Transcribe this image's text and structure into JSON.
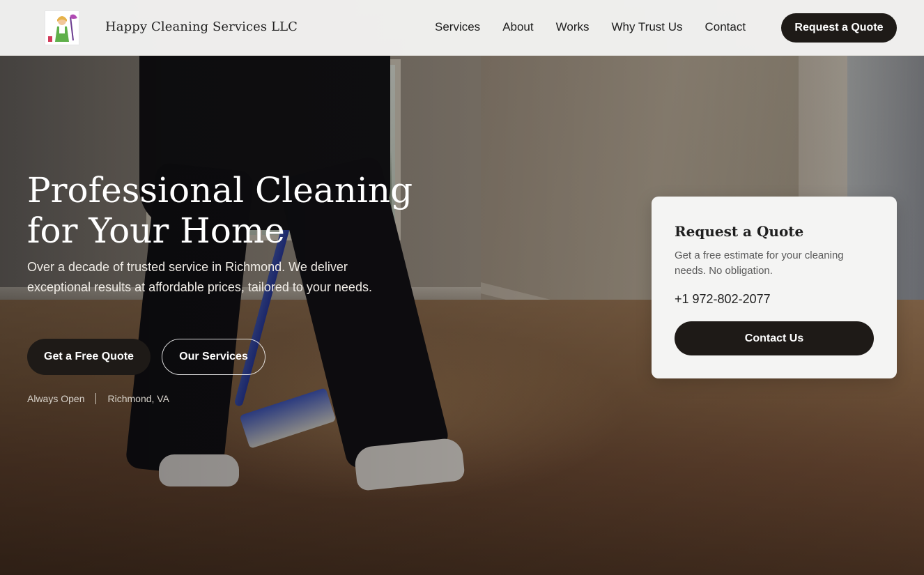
{
  "header": {
    "brand": "Happy Cleaning Services LLC",
    "nav": [
      "Services",
      "About",
      "Works",
      "Why Trust Us",
      "Contact"
    ],
    "cta": "Request a Quote"
  },
  "hero": {
    "title": "Professional Cleaning for Your Home",
    "subtitle": "Over a decade of trusted service in Richmond. We deliver exceptional results at affordable prices, tailored to your needs.",
    "primary_button": "Get a Free Quote",
    "secondary_button": "Our Services",
    "hours": "Always Open",
    "location": "Richmond, VA"
  },
  "quote_card": {
    "title": "Request a Quote",
    "description": "Get a free estimate for your cleaning needs. No obligation.",
    "phone": "+1 972-802-2077",
    "button": "Contact Us"
  },
  "colors": {
    "accent_dark": "#1e1a17",
    "card_bg": "#f4f4f3",
    "header_bg": "#f4f4f2"
  },
  "icons": {
    "logo": "cleaning-lady-logo-icon"
  }
}
